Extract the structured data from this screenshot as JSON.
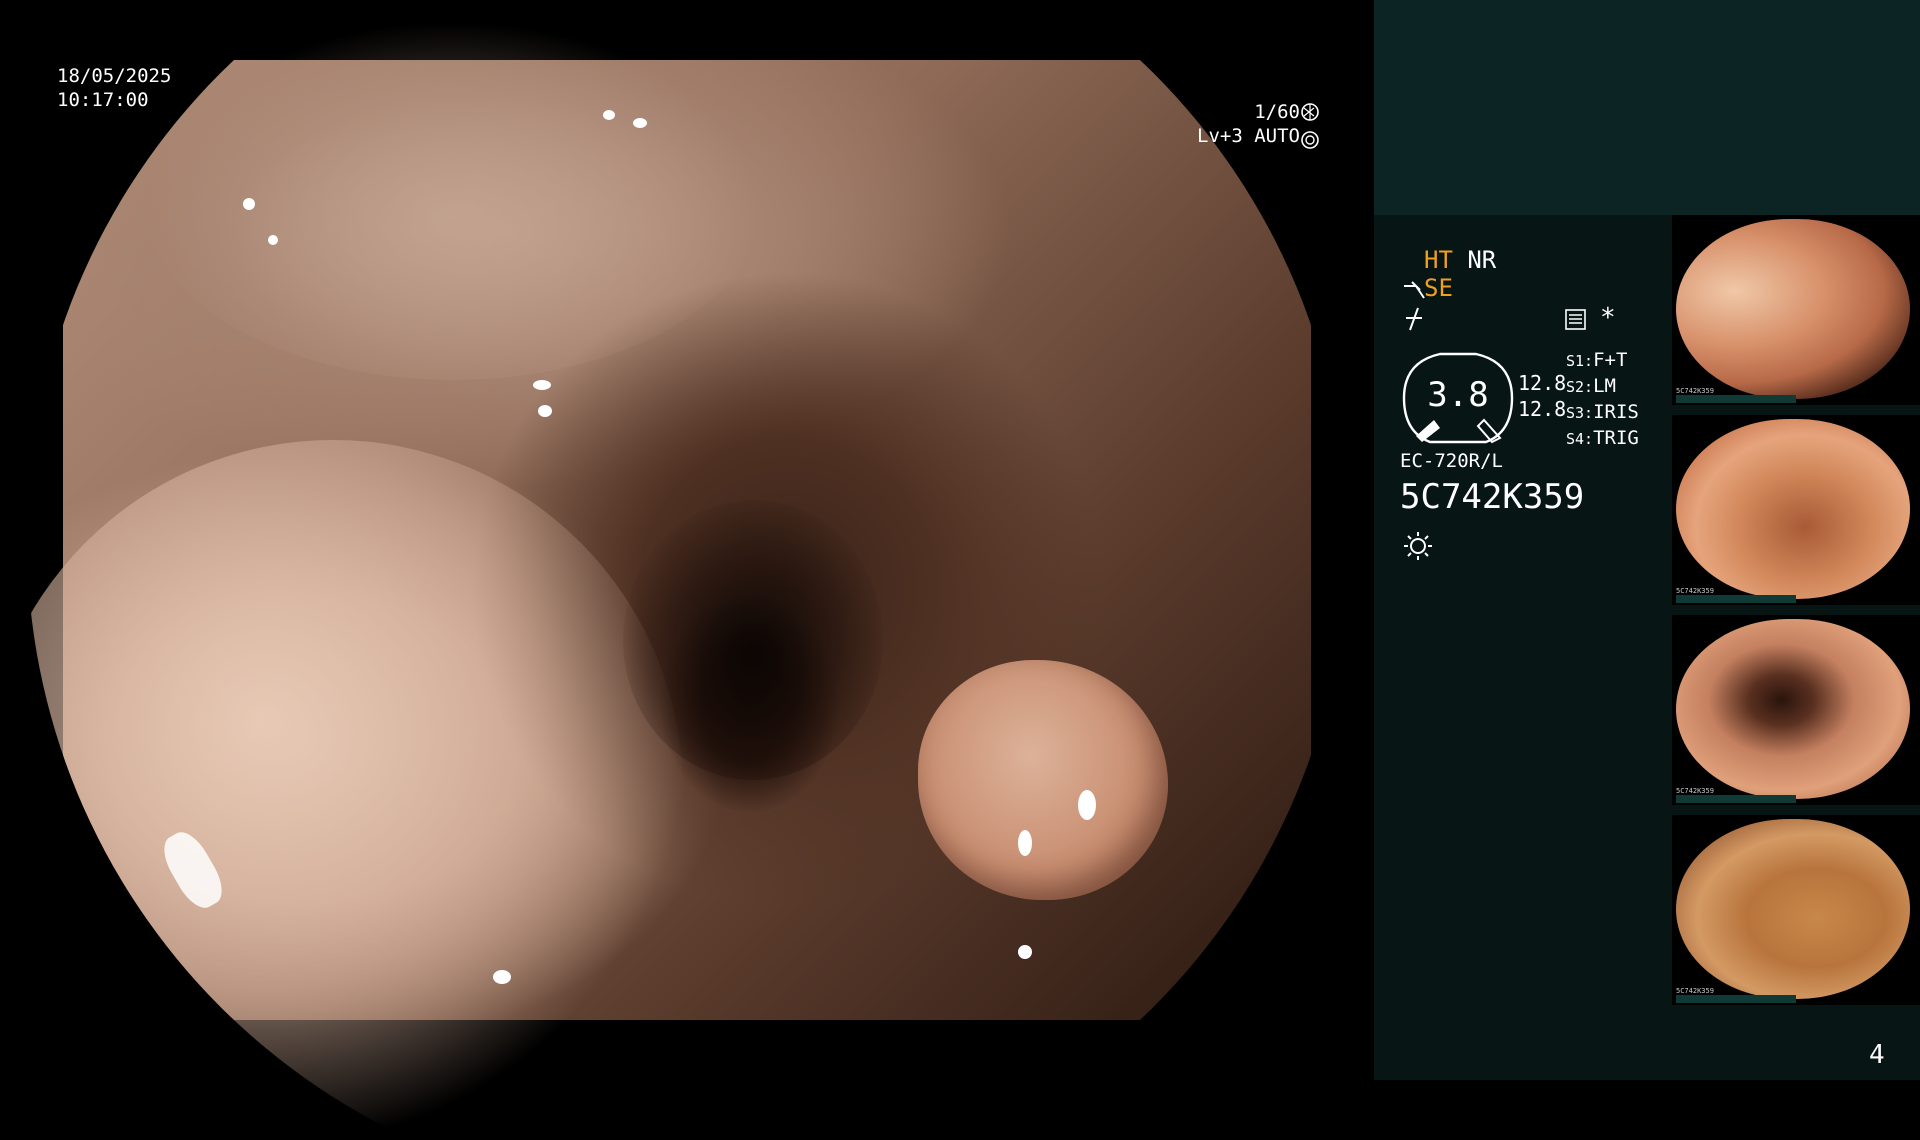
{
  "osd": {
    "date": "18/05/2025",
    "time": "10:17:00",
    "shutter": "1/60",
    "level": "Lv+3 AUTO"
  },
  "sidebar": {
    "modes": {
      "ht": "HT",
      "nr": "NR",
      "se": "SE"
    },
    "gauge_value": "3.8",
    "gauge_right_top": "12.8",
    "gauge_right_bottom": "12.8",
    "switches": [
      {
        "key": "S1:",
        "value": "F+T"
      },
      {
        "key": "S2:",
        "value": "LM"
      },
      {
        "key": "S3:",
        "value": "IRIS"
      },
      {
        "key": "S4:",
        "value": "TRIG"
      }
    ],
    "asterisk": "*",
    "scope_model": "EC-720R/L",
    "serial": "5C742K359",
    "page_number": "4",
    "thumb_serial": "5C742K359"
  },
  "colors": {
    "sidebar_bg": "#071614",
    "sidebar_top_bg": "#0d2425",
    "accent_orange": "#f0a020"
  }
}
